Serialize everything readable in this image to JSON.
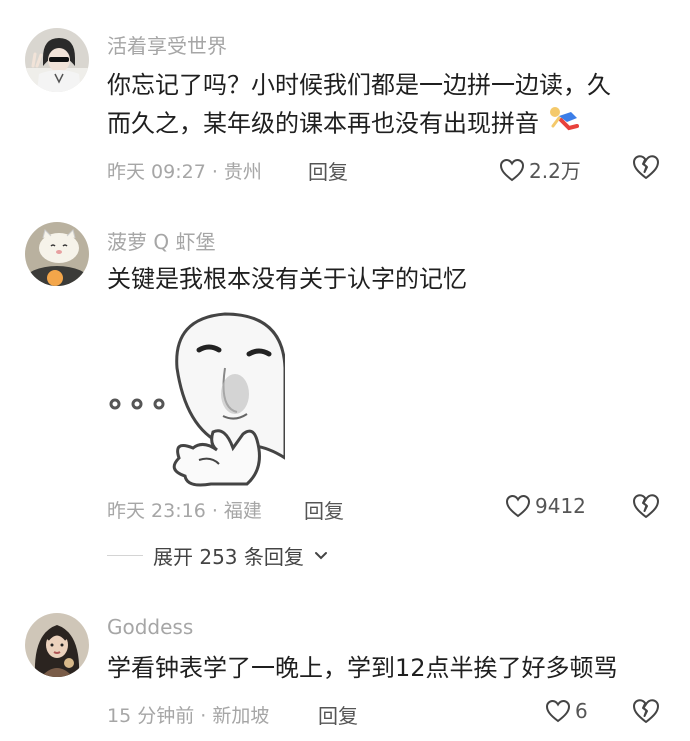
{
  "comments": [
    {
      "username": "活着享受世界",
      "lines": [
        "你忘记了吗？小时候我们都是一边拼一边读，久",
        "而久之，某年级的课本再也没有出现拼音"
      ],
      "meta": "昨天 09:27 · 贵州",
      "reply_label": "回复",
      "likes": "2.2万",
      "avatar_icon": "girl-peace-sign-avatar",
      "trailing_emoji": "running-figure-emoji"
    },
    {
      "username": "菠萝 Q 虾堡",
      "lines": [
        "关键是我根本没有关于认字的记忆"
      ],
      "meta": "昨天 23:16 · 福建",
      "reply_label": "回复",
      "likes": "9412",
      "avatar_icon": "cartoon-cat-avatar",
      "sticker_icon": "thinking-meme-sticker"
    },
    {
      "username": "Goddess",
      "lines": [
        "学看钟表学了一晚上，学到12点半挨了好多顿骂"
      ],
      "meta": "15 分钟前 · 新加坡",
      "reply_label": "回复",
      "likes": "6",
      "avatar_icon": "woman-portrait-avatar"
    }
  ],
  "expand_replies": "展开 253 条回复",
  "colors": {
    "meta_gray": "#a6a6a6",
    "text": "#1f1f1f",
    "background": "#ffffff"
  }
}
